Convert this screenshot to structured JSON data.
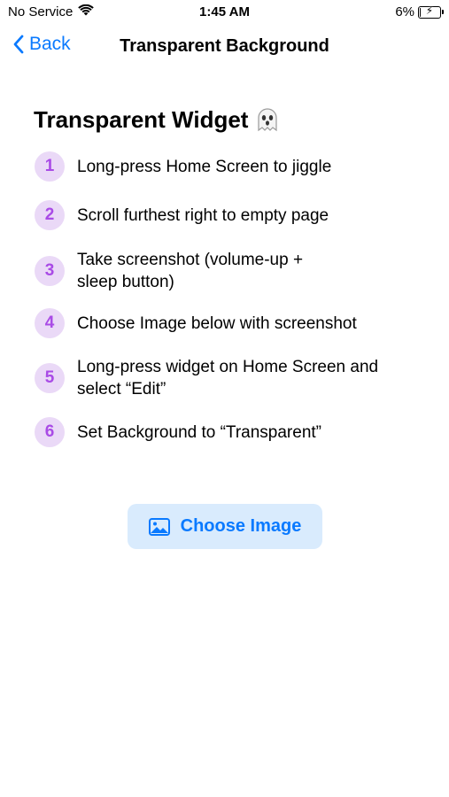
{
  "status_bar": {
    "carrier": "No Service",
    "time": "1:45 AM",
    "battery_percent": "6%",
    "battery_level": 0.06,
    "wifi_icon": "wifi-icon",
    "battery_icon": "battery-charging-icon"
  },
  "nav": {
    "back_label": "Back",
    "title": "Transparent Background",
    "back_icon": "chevron-left-icon"
  },
  "widget": {
    "title": "Transparent Widget",
    "title_icon": "ghost-emoji-icon"
  },
  "steps": [
    {
      "number": "1",
      "text": "Long-press Home Screen to jiggle"
    },
    {
      "number": "2",
      "text": "Scroll furthest right to empty page"
    },
    {
      "number": "3",
      "text": "Take screenshot (volume-up +\nsleep button)"
    },
    {
      "number": "4",
      "text": "Choose Image below with screenshot"
    },
    {
      "number": "5",
      "text": "Long-press widget on Home Screen and\nselect “Edit”"
    },
    {
      "number": "6",
      "text": "Set Background to “Transparent”"
    }
  ],
  "choose_button": {
    "label": "Choose Image",
    "icon": "photo-icon"
  },
  "colors": {
    "accent": "#0a7aff",
    "step_badge_bg": "#ead9f7",
    "step_badge_text": "#a94be6",
    "button_bg": "#d9ebfd"
  }
}
